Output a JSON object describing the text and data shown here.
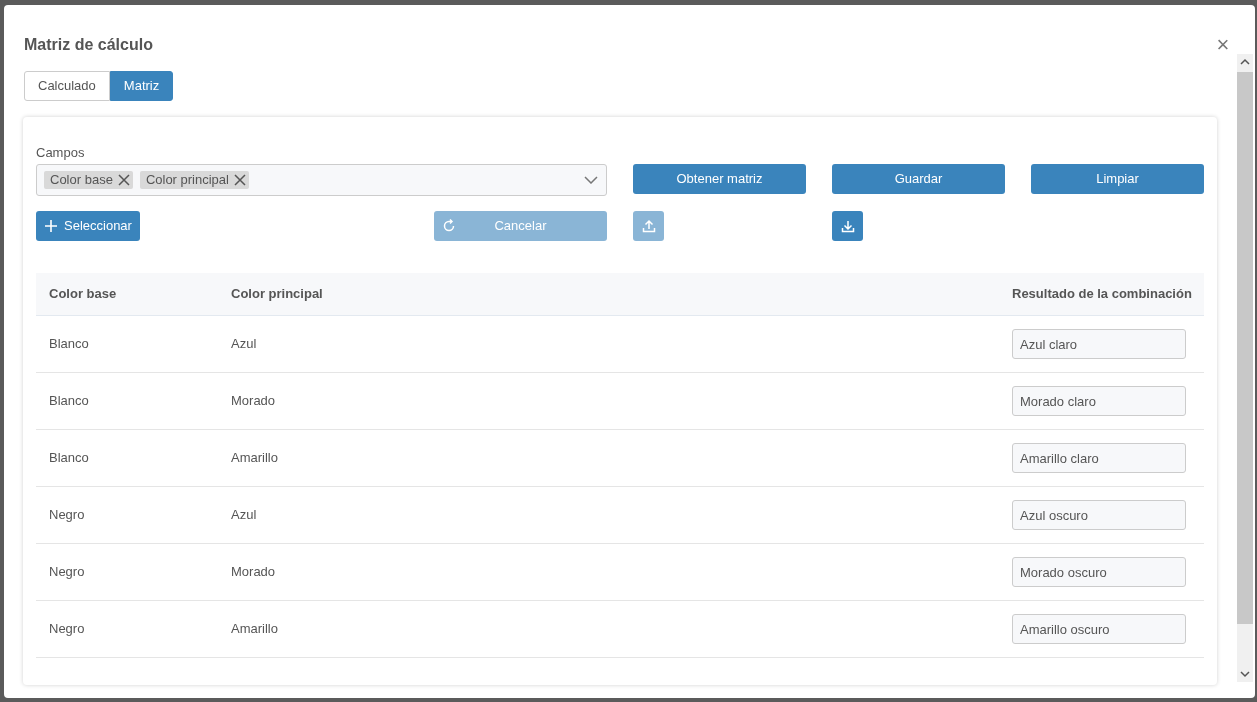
{
  "dialog": {
    "title": "Matriz de cálculo",
    "close_glyph": "×"
  },
  "tabs": [
    {
      "label": "Calculado",
      "selected": false
    },
    {
      "label": "Matriz",
      "selected": true
    }
  ],
  "fields": {
    "label": "Campos",
    "tags": [
      {
        "label": "Color base"
      },
      {
        "label": "Color principal"
      }
    ]
  },
  "actions": [
    {
      "label": "Obtener matriz",
      "disabled": false
    },
    {
      "label": "Guardar",
      "disabled": false
    },
    {
      "label": "Limpiar",
      "disabled": false
    }
  ],
  "secondary_actions": [
    {
      "kind": "add",
      "label": "Seleccionar",
      "disabled": false
    },
    {
      "kind": "refresh",
      "label": "Cancelar",
      "disabled": true
    },
    {
      "kind": "upload",
      "disabled": true
    },
    {
      "kind": "download",
      "disabled": false
    }
  ],
  "table": {
    "columns": [
      "Color base",
      "Color principal",
      "Resultado de la combinación"
    ],
    "rows": [
      {
        "color_base": "Blanco",
        "color_principal": "Azul",
        "resultado": "Azul claro"
      },
      {
        "color_base": "Blanco",
        "color_principal": "Morado",
        "resultado": "Morado claro"
      },
      {
        "color_base": "Blanco",
        "color_principal": "Amarillo",
        "resultado": "Amarillo claro"
      },
      {
        "color_base": "Negro",
        "color_principal": "Azul",
        "resultado": "Azul oscuro"
      },
      {
        "color_base": "Negro",
        "color_principal": "Morado",
        "resultado": "Morado oscuro"
      },
      {
        "color_base": "Negro",
        "color_principal": "Amarillo",
        "resultado": "Amarillo oscuro"
      }
    ]
  }
}
